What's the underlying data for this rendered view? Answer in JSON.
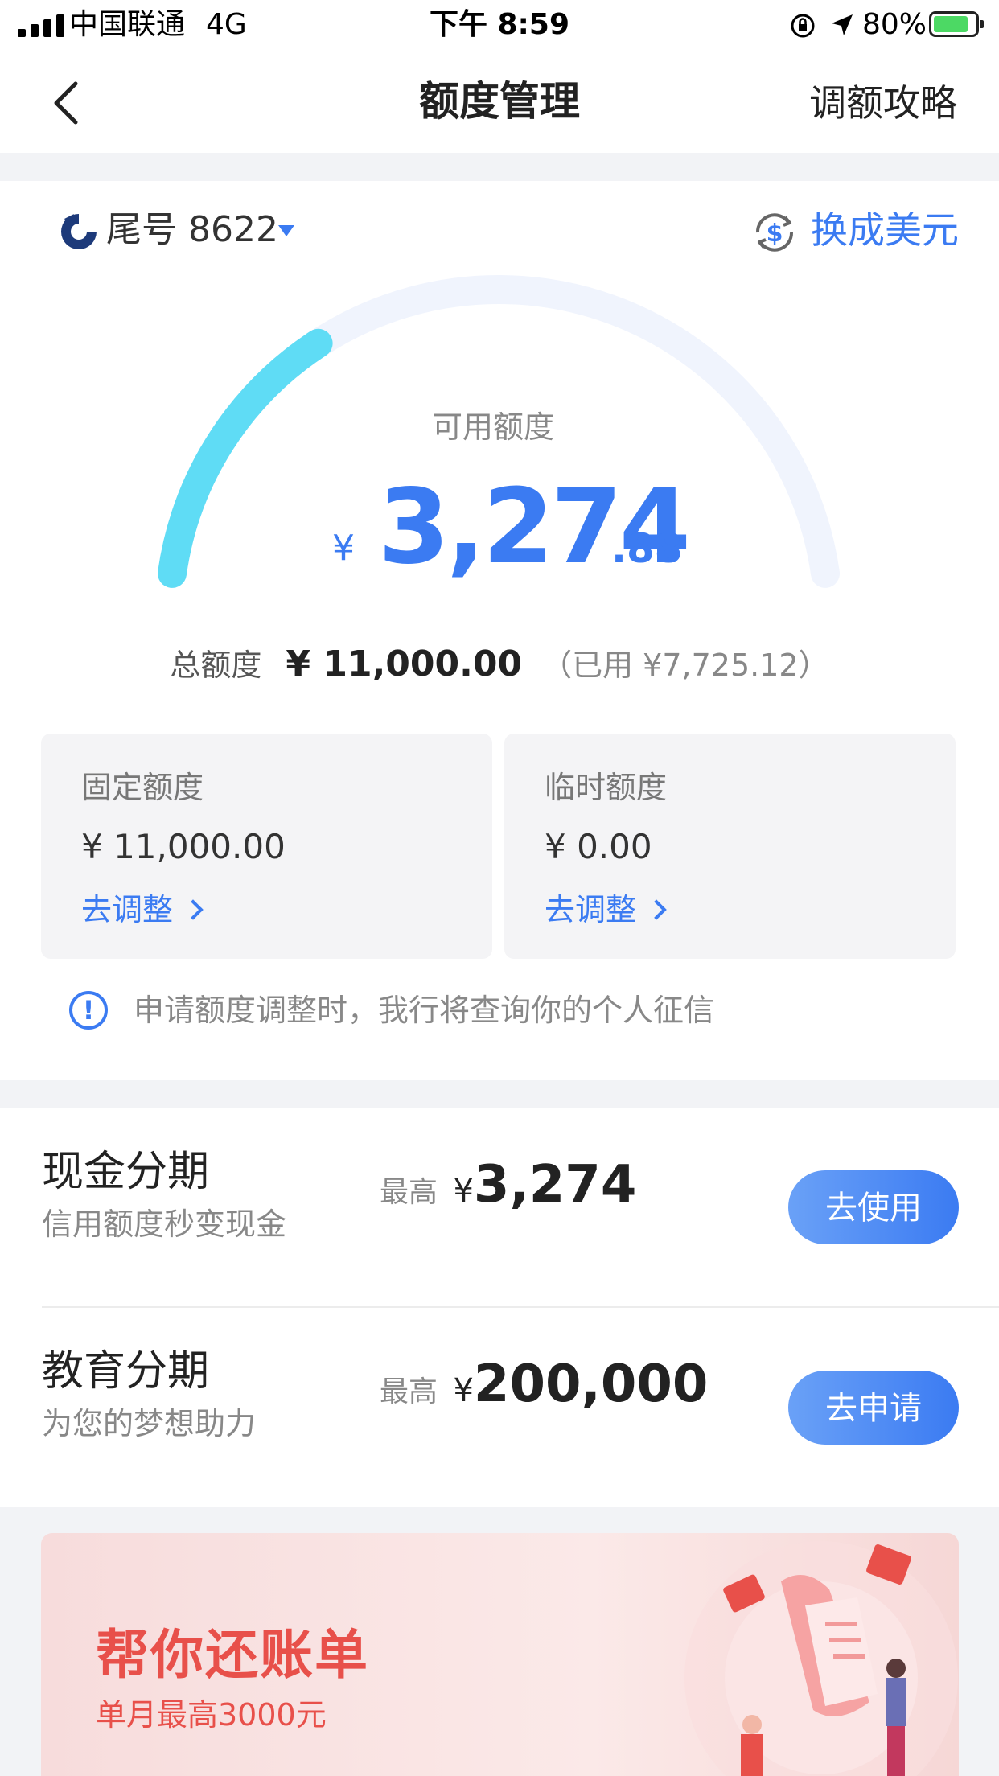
{
  "status_bar": {
    "carrier": "中国联通",
    "network": "4G",
    "time": "下午 8:59",
    "battery": "80%"
  },
  "nav": {
    "title": "额度管理",
    "right_link": "调额攻略"
  },
  "card": {
    "label": "尾号 8622",
    "currency_switch": "换成美元"
  },
  "available": {
    "label": "可用额度",
    "currency": "¥",
    "amount_int": "3,274",
    "amount_dec": ".88",
    "gauge_fraction": 0.2977
  },
  "total": {
    "label": "总额度",
    "value": "¥ 11,000.00",
    "used": "（已用 ¥7,725.12）"
  },
  "fixed_limit": {
    "title": "固定额度",
    "value": "¥ 11,000.00",
    "link": "去调整"
  },
  "temp_limit": {
    "title": "临时额度",
    "value": "¥ 0.00",
    "link": "去调整"
  },
  "notice": {
    "icon": "!",
    "text": "申请额度调整时，我行将查询你的个人征信"
  },
  "products": [
    {
      "title": "现金分期",
      "subtitle": "信用额度秒变现金",
      "max_label": "最高",
      "currency": "¥",
      "amount": "3,274",
      "button": "去使用"
    },
    {
      "title": "教育分期",
      "subtitle": "为您的梦想助力",
      "max_label": "最高",
      "currency": "¥",
      "amount": "200,000",
      "button": "去申请"
    }
  ],
  "banner": {
    "title": "帮你还账单",
    "subtitle": "单月最高3000元"
  },
  "colors": {
    "accent": "#3b7bf2",
    "gauge_fill": "#5fdcf5",
    "gauge_track": "#f0f4fd",
    "banner_red": "#e8504a"
  }
}
